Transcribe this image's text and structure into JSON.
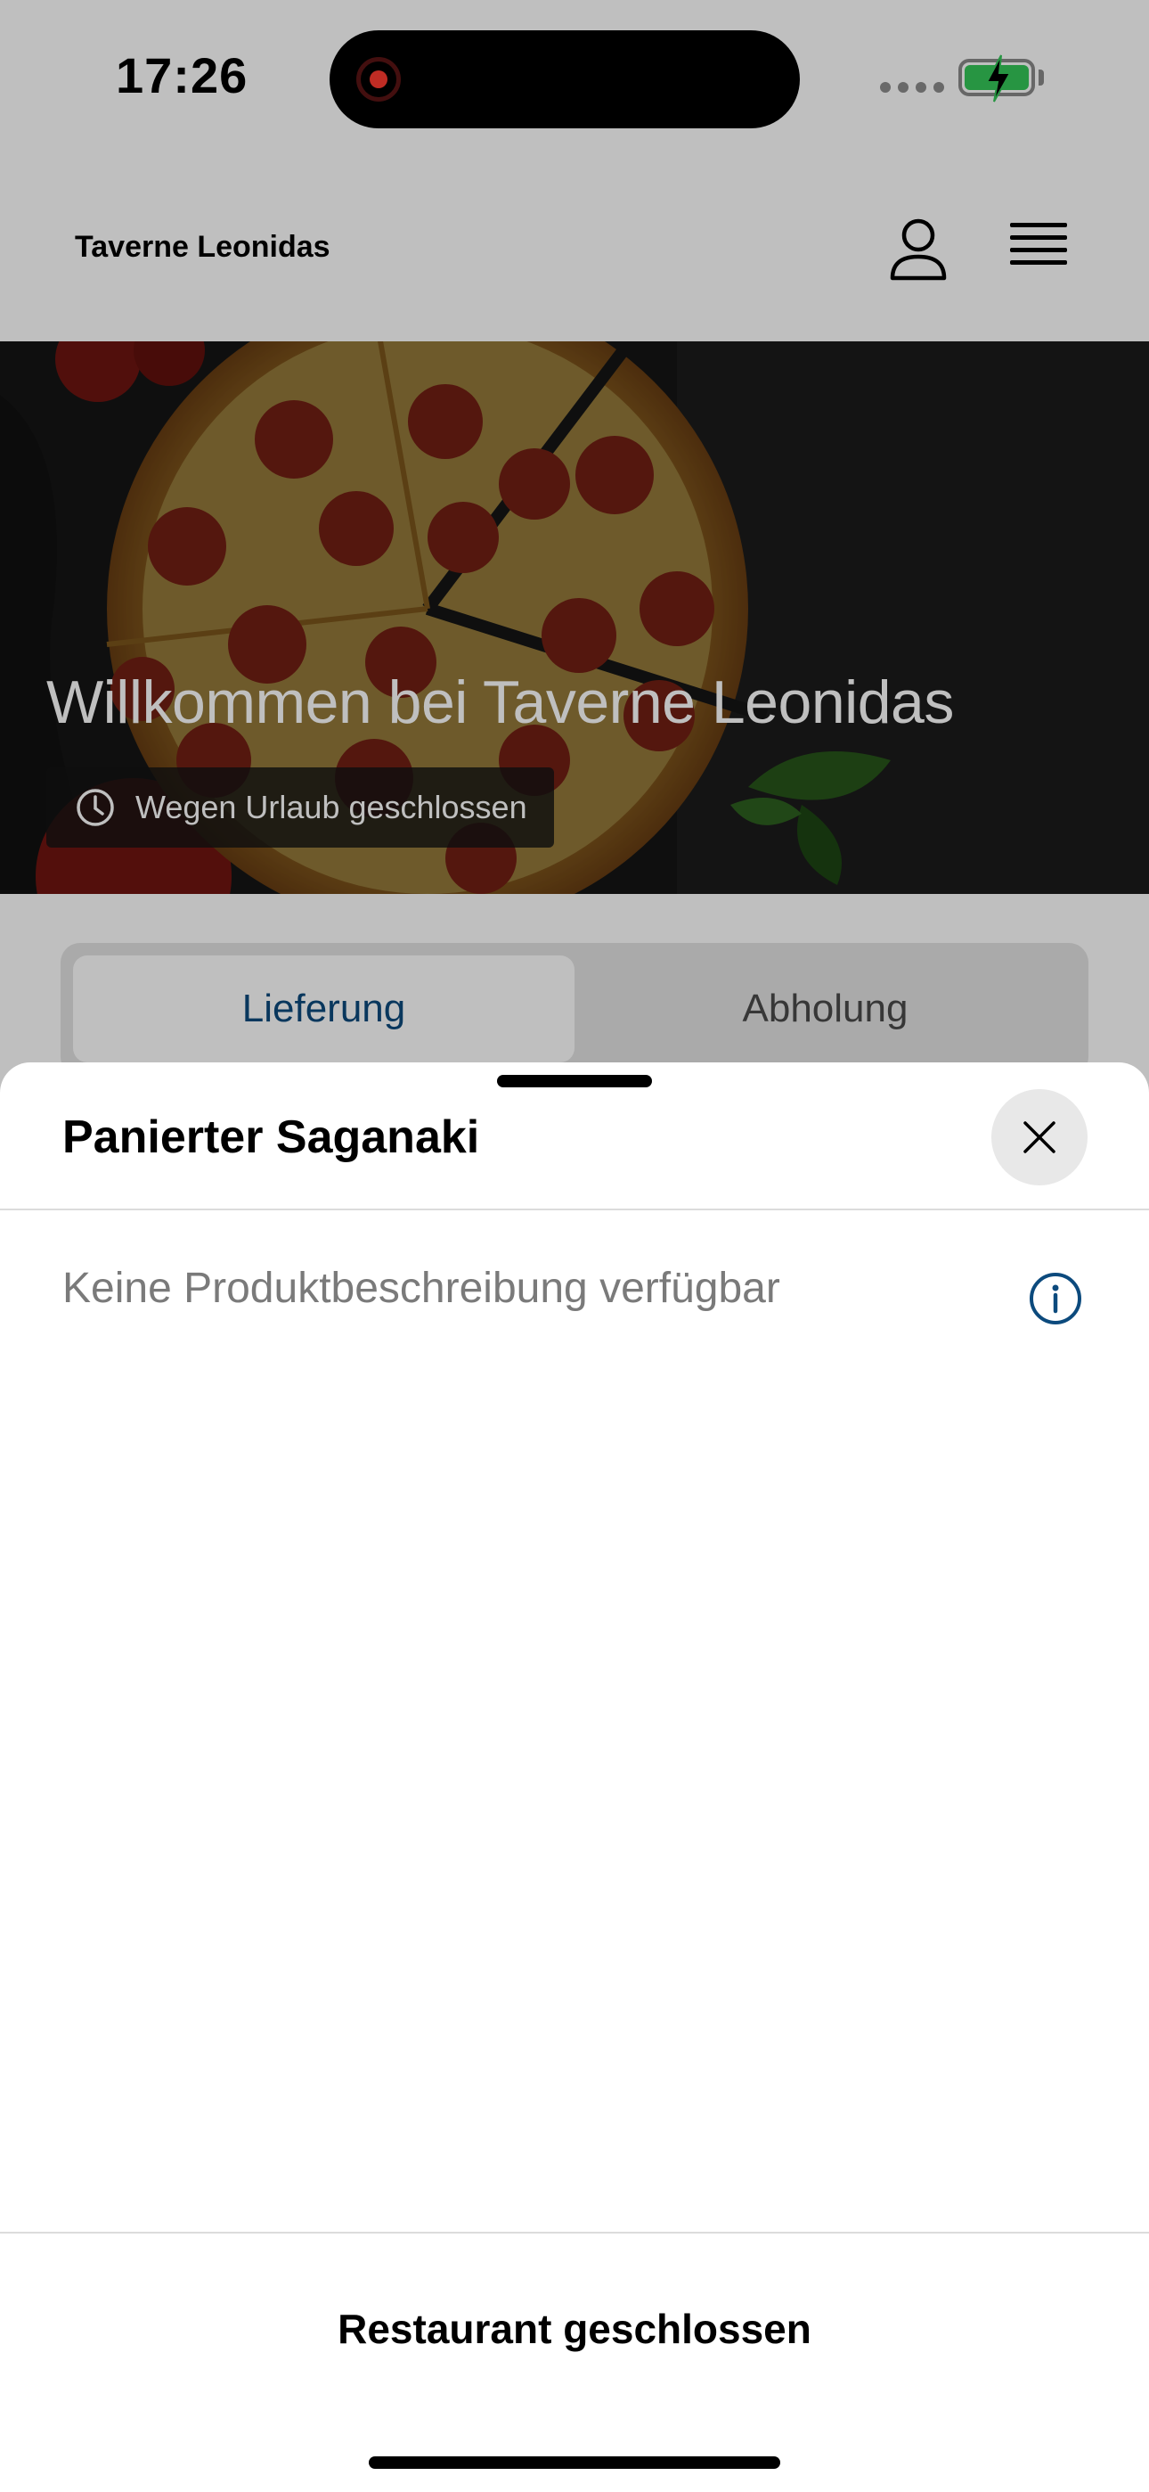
{
  "status_bar": {
    "time": "17:26",
    "recording_icon": "screen-recording-icon",
    "battery_state": "charging",
    "battery_color": "#34c759"
  },
  "header": {
    "title": "Taverne Leonidas",
    "account_icon": "user-icon",
    "menu_icon": "hamburger-menu-icon"
  },
  "hero": {
    "title": "Willkommen bei Taverne Leonidas",
    "status_icon": "clock-icon",
    "status_text": "Wegen Urlaub geschlossen"
  },
  "mode_tabs": [
    {
      "label": "Lieferung",
      "active": true
    },
    {
      "label": "Abholung",
      "active": false
    }
  ],
  "sheet": {
    "title": "Panierter Saganaki",
    "close_icon": "close-icon",
    "description": "Keine Produktbeschreibung verfügbar",
    "info_icon": "info-icon",
    "footer_status": "Restaurant geschlossen"
  },
  "colors": {
    "accent": "#0c4a7d",
    "overlay": "rgba(0,0,0,0.25)",
    "muted_text": "#7a7a7a"
  }
}
